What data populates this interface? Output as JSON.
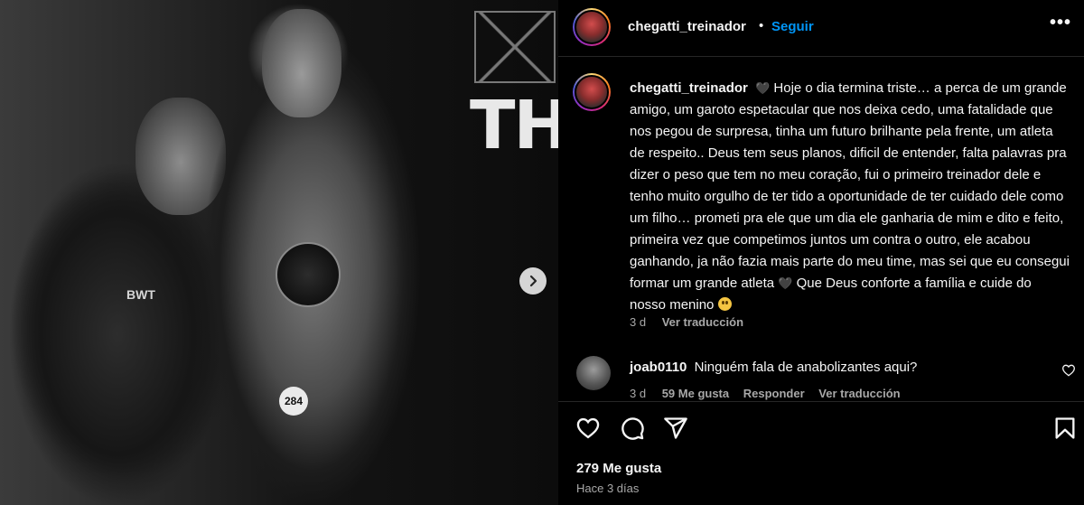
{
  "post": {
    "username": "chegatti_treinador",
    "follow_label": "Seguir",
    "more_label": "•••",
    "caption": "Hoje o dia termina triste… a perca de um grande amigo, um garoto espetacular que nos deixa cedo, uma fatalidade que nos pegou de surpresa, tinha um futuro brilhante pela frente, um atleta de respeito.. Deus tem seus planos, dificil de entender, falta palavras pra dizer o peso que tem no meu coração, fui o primeiro treinador dele e tenho muito orgulho de ter tido a oportunidade de ter cuidado dele como um filho… prometi pra ele que um dia ele ganharia de mim e dito e feito, primeira vez que competimos juntos um contra o outro, ele acabou ganhando, ja não fazia mais parte do meu time, mas sei que eu consegui formar um grande atleta",
    "caption_end": "Que Deus conforte a família e cuide do nosso menino",
    "caption_time": "3 d",
    "caption_translate": "Ver traducción",
    "likes": "279 Me gusta",
    "time_ago": "Hace 3 días"
  },
  "photo": {
    "bg_text": "THE",
    "bib_number": "284",
    "shirt_logo": "BWT",
    "next_icon": "chevron-right-icon"
  },
  "comments": [
    {
      "username": "joab0110",
      "text": "Ninguém fala de anabolizantes aqui?",
      "time": "3 d",
      "likes": "59 Me gusta",
      "reply_label": "Responder",
      "translate_label": "Ver traducción"
    }
  ],
  "icons": {
    "like": "heart-icon",
    "comment": "comment-icon",
    "share": "share-icon",
    "save": "bookmark-icon"
  },
  "colors": {
    "background": "#000000",
    "text": "#f5f5f5",
    "secondary": "#a8a8a8",
    "link": "#0095f6",
    "divider": "#262626"
  }
}
